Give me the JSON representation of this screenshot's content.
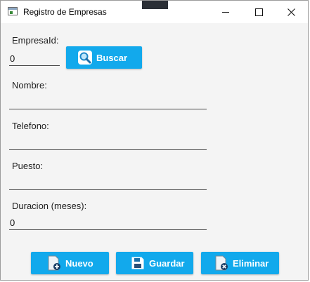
{
  "window": {
    "title": "Registro de Empresas"
  },
  "form": {
    "empresa_id": {
      "label": "EmpresaId:",
      "value": "0"
    },
    "nombre": {
      "label": "Nombre:",
      "value": ""
    },
    "telefono": {
      "label": "Telefono:",
      "value": ""
    },
    "puesto": {
      "label": "Puesto:",
      "value": ""
    },
    "duracion": {
      "label": "Duracion (meses):",
      "value": "0"
    }
  },
  "buttons": {
    "buscar": "Buscar",
    "nuevo": "Nuevo",
    "guardar": "Guardar",
    "eliminar": "Eliminar"
  },
  "colors": {
    "accent": "#12a9ec",
    "window_bg": "#f4f4f4"
  },
  "icons": {
    "buscar": "magnifier-icon",
    "nuevo": "new-document-icon",
    "guardar": "floppy-disk-icon",
    "eliminar": "delete-document-icon"
  }
}
